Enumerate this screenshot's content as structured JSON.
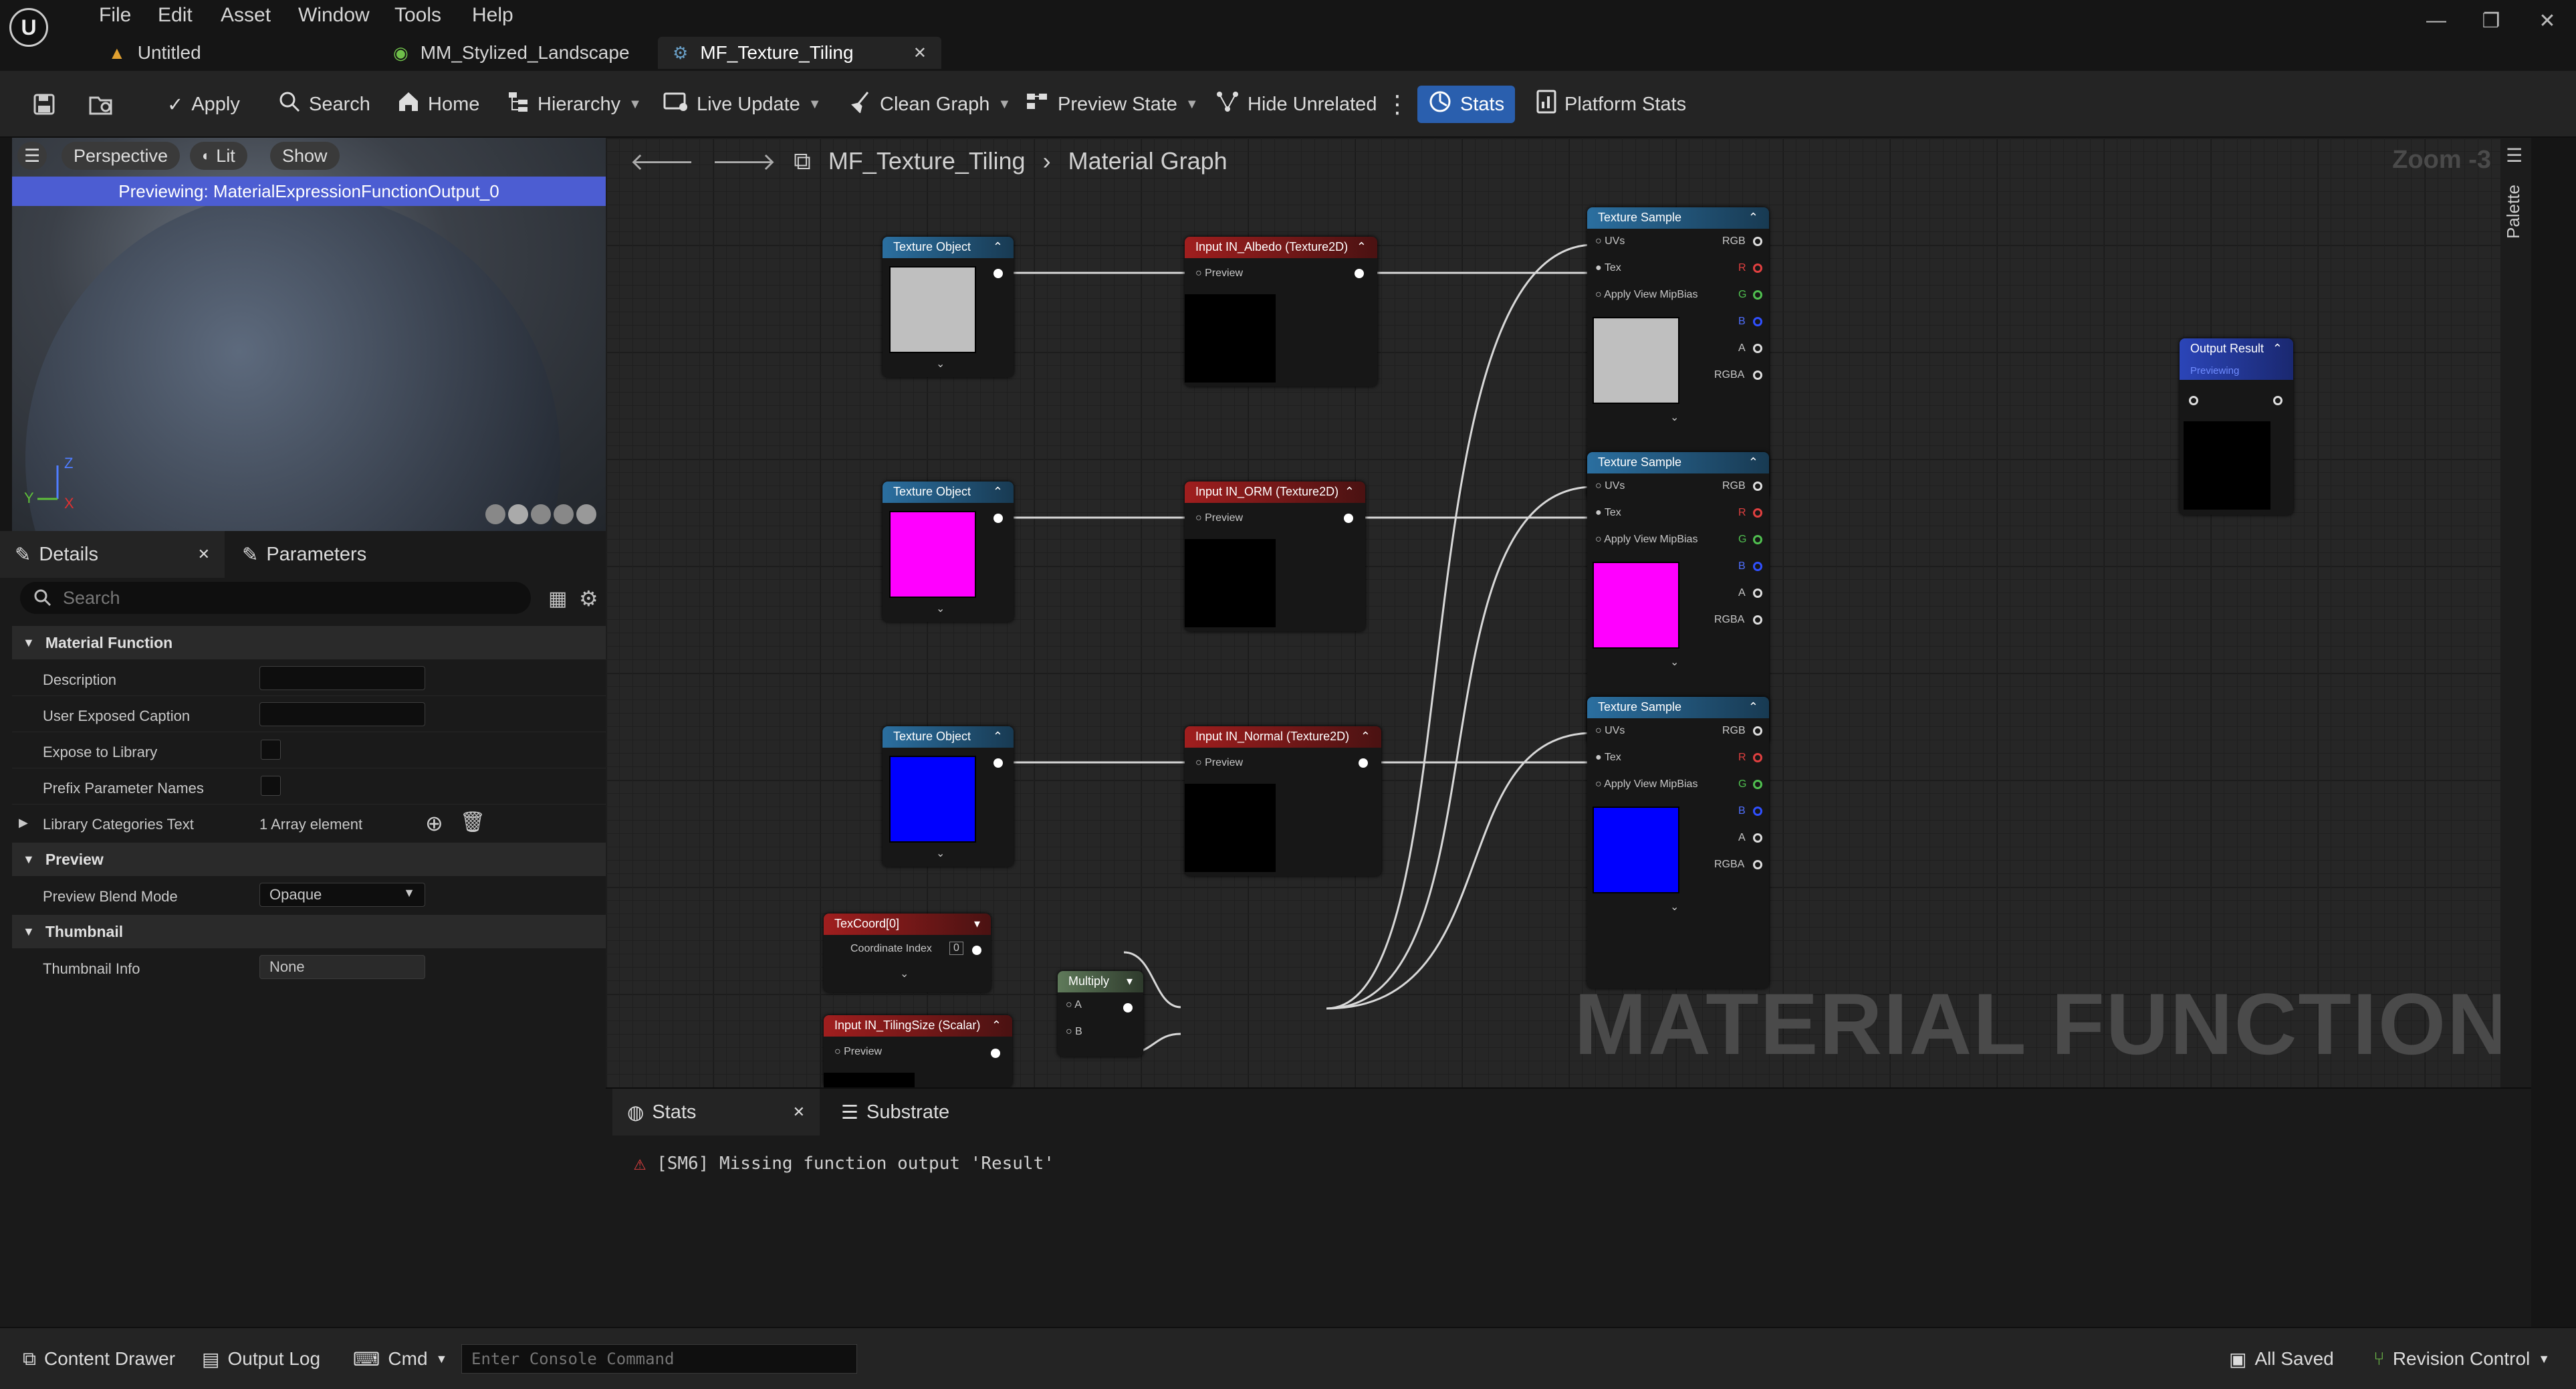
{
  "menu": [
    "File",
    "Edit",
    "Asset",
    "Window",
    "Tools",
    "Help"
  ],
  "tabs": [
    {
      "label": "Untitled"
    },
    {
      "label": "MM_Stylized_Landscape"
    },
    {
      "label": "MF_Texture_Tiling",
      "close": "✕"
    }
  ],
  "toolbar": {
    "apply": "Apply",
    "search": "Search",
    "home": "Home",
    "hierarchy": "Hierarchy",
    "live_update": "Live Update",
    "clean_graph": "Clean Graph",
    "preview_state": "Preview State",
    "hide_unrelated": "Hide Unrelated",
    "stats": "Stats",
    "platform_stats": "Platform Stats"
  },
  "viewport": {
    "perspective": "Perspective",
    "lit": "Lit",
    "show": "Show",
    "banner": "Previewing: MaterialExpressionFunctionOutput_0",
    "axis_z": "Z",
    "axis_x": "X",
    "axis_y": "Y"
  },
  "details": {
    "tab_details": "Details",
    "tab_parameters": "Parameters",
    "search_placeholder": "Search",
    "section_material_function": "Material Function",
    "description": "Description",
    "user_exposed_caption": "User Exposed Caption",
    "expose_to_library": "Expose to Library",
    "prefix_parameter_names": "Prefix Parameter Names",
    "library_categories_text": "Library Categories Text",
    "library_categories_value": "1 Array element",
    "section_preview": "Preview",
    "preview_blend_mode": "Preview Blend Mode",
    "preview_blend_mode_value": "Opaque",
    "section_thumbnail": "Thumbnail",
    "thumbnail_info": "Thumbnail Info",
    "thumbnail_info_value": "None"
  },
  "graph": {
    "breadcrumb_root": "MF_Texture_Tiling",
    "breadcrumb_sep": "›",
    "breadcrumb_leaf": "Material Graph",
    "zoom": "Zoom -3",
    "palette": "Palette",
    "watermark": "MATERIAL FUNCTION",
    "texture_object": "Texture Object",
    "input_albedo": "Input IN_Albedo (Texture2D)",
    "input_orm": "Input IN_ORM (Texture2D)",
    "input_normal": "Input IN_Normal (Texture2D)",
    "preview": "Preview",
    "texture_sample": "Texture Sample",
    "pins": {
      "uvs": "UVs",
      "tex": "Tex",
      "mip": "Apply View MipBias",
      "rgb": "RGB",
      "r": "R",
      "g": "G",
      "b": "B",
      "a": "A",
      "rgba": "RGBA"
    },
    "texcoord": "TexCoord[0]",
    "coordinate_index": "Coordinate Index",
    "coordinate_index_value": "0",
    "input_tiling": "Input IN_TilingSize (Scalar)",
    "multiply": "Multiply",
    "multiply_a": "A",
    "multiply_b": "B",
    "output_result": "Output Result",
    "output_previewing": "Previewing"
  },
  "stats_panel": {
    "tab_stats": "Stats",
    "tab_substrate": "Substrate",
    "message": "[SM6] Missing function output 'Result'"
  },
  "statusbar": {
    "content_drawer": "Content Drawer",
    "output_log": "Output Log",
    "cmd": "Cmd",
    "console_placeholder": "Enter Console Command",
    "all_saved": "All Saved",
    "revision_control": "Revision Control"
  },
  "colors": {
    "accent": "#2a5fae",
    "albedo_swatch": "#bfbfbf",
    "orm_swatch": "#ff00ff",
    "normal_swatch": "#0000ff"
  },
  "icons": [
    "unreal-logo-icon",
    "save-icon",
    "browse-icon",
    "apply-icon",
    "search-icon",
    "home-icon",
    "hierarchy-icon",
    "live-update-icon",
    "clean-graph-icon",
    "preview-state-icon",
    "hide-unrelated-icon",
    "stats-icon",
    "platform-stats-icon",
    "warning-icon"
  ]
}
